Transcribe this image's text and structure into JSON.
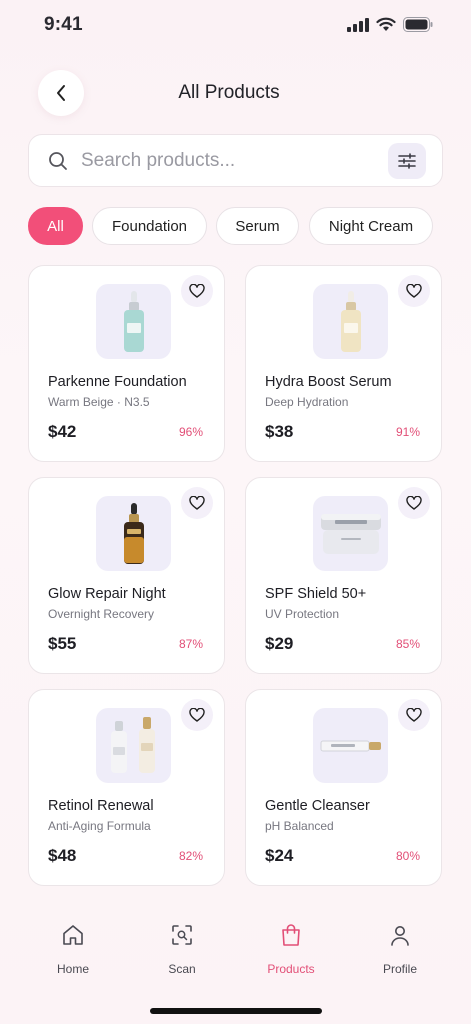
{
  "status_bar": {
    "time": "9:41"
  },
  "header": {
    "title": "All Products"
  },
  "search": {
    "placeholder": "Search products..."
  },
  "chips": [
    "All",
    "Foundation",
    "Serum",
    "Night Cream"
  ],
  "products": [
    {
      "name": "Parkenne Foundation",
      "subtitle": "Warm Beige · N3.5",
      "price": "$42",
      "match": "96%"
    },
    {
      "name": "Hydra Boost Serum",
      "subtitle": "Deep Hydration",
      "price": "$38",
      "match": "91%"
    },
    {
      "name": "Glow Repair Night",
      "subtitle": "Overnight Recovery",
      "price": "$55",
      "match": "87%"
    },
    {
      "name": "SPF Shield 50+",
      "subtitle": "UV Protection",
      "price": "$29",
      "match": "85%"
    },
    {
      "name": "Retinol Renewal",
      "subtitle": "Anti-Aging Formula",
      "price": "$48",
      "match": "82%"
    },
    {
      "name": "Gentle Cleanser",
      "subtitle": "pH Balanced",
      "price": "$24",
      "match": "80%"
    }
  ],
  "nav": [
    {
      "label": "Home",
      "icon": "home-icon"
    },
    {
      "label": "Scan",
      "icon": "scan-icon"
    },
    {
      "label": "Products",
      "icon": "bag-icon",
      "active": true
    },
    {
      "label": "Profile",
      "icon": "user-icon"
    }
  ],
  "colors": {
    "accent": "#f24f79",
    "match_text": "#e24f77",
    "thumb_bg": "#efedf9"
  }
}
